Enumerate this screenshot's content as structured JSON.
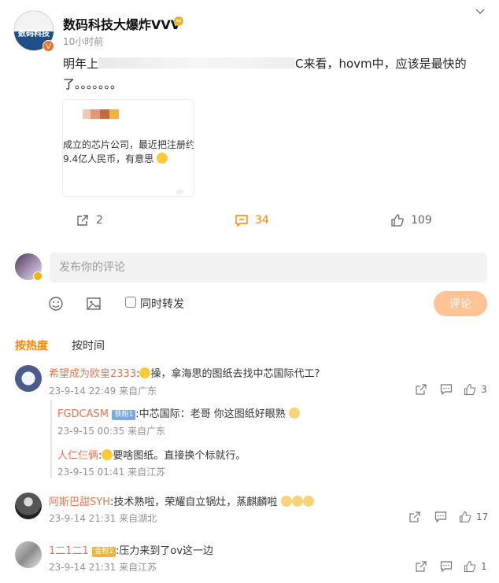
{
  "post": {
    "author": "数码科技大爆炸VVV",
    "avatar_text": "数码科技",
    "verified_badge": "V",
    "time": "10小时前",
    "text_prefix": "明年上",
    "text_suffix": "C来看，hovm中，应该是最快的",
    "text_line2": "了。。。。。。。",
    "card_text": "成立的芯片公司，最近把注册约9.4亿人民币，有意思",
    "actions": {
      "repost_count": "2",
      "comment_count": "34",
      "like_count": "109"
    },
    "icons": [
      "chevron-down-icon",
      "crown-icon",
      "repost-icon",
      "comment-icon",
      "like-icon"
    ]
  },
  "composer": {
    "placeholder": "发布你的评论",
    "repost_label": "同时转发",
    "submit_label": "评论",
    "tools": [
      "emoji-icon",
      "image-icon"
    ]
  },
  "sort_tabs": [
    {
      "label": "按热度",
      "active": true
    },
    {
      "label": "按时间",
      "active": false
    }
  ],
  "comments": [
    {
      "user": "希望成为欧皇2333",
      "text": "操，拿海思的图纸去找中芯国际代工?",
      "time": "23-9-14 22:49",
      "location": "来自广东",
      "likes": "3",
      "replies": [
        {
          "user": "FGDCASM",
          "badge": "铁粉1",
          "text": ":中芯国际：老哥 你这图纸好眼熟",
          "time": "23-9-15 00:35",
          "location": "来自广东"
        },
        {
          "user": "人仁仨俩",
          "text": "要啥图纸。直接换个标就行。",
          "time": "23-9-15 01:41",
          "location": "来自江苏"
        }
      ]
    },
    {
      "user": "阿斯巴甜SYH",
      "text": ":技术熟啦，荣耀自立锅灶，蒸麒麟啦",
      "time": "23-9-14 21:31",
      "location": "来自湖北",
      "likes": "17"
    },
    {
      "user": "1二1二1",
      "badge": "金粉2",
      "text": ":压力来到了ov这一边",
      "time": "23-9-14 21:31",
      "location": "来自江苏",
      "likes": "1"
    }
  ],
  "colors": {
    "accent": "#ff8200",
    "name": "#eb7350",
    "submit_disabled": "#ffc396"
  }
}
